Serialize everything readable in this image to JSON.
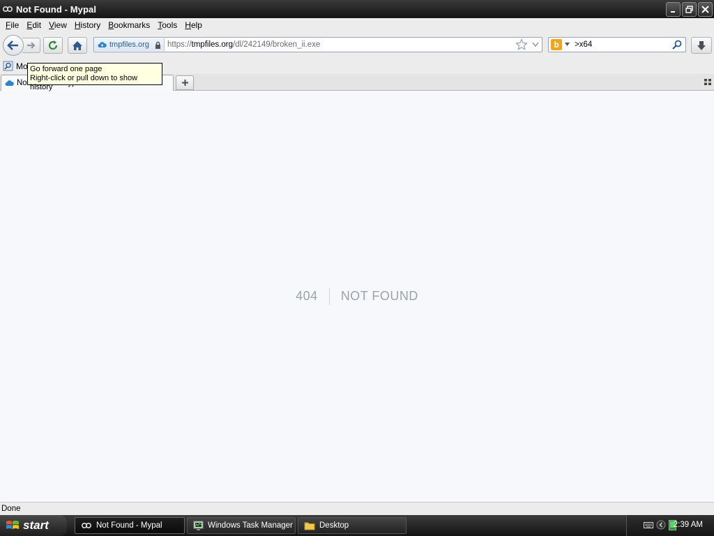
{
  "window": {
    "title": "Not Found - Mypal",
    "controls": {
      "minimize": "minimize",
      "restore": "restore",
      "close": "close"
    }
  },
  "menu": [
    {
      "accel": "F",
      "rest": "ile"
    },
    {
      "accel": "E",
      "rest": "dit"
    },
    {
      "accel": "V",
      "rest": "iew"
    },
    {
      "accel": "H",
      "rest": "istory"
    },
    {
      "accel": "B",
      "rest": "ookmarks"
    },
    {
      "accel": "T",
      "rest": "ools"
    },
    {
      "accel": "H",
      "rest": "elp"
    }
  ],
  "navbar": {
    "identity_label": "tmpfiles.org",
    "url_prefix": "https://",
    "url_host": "tmpfiles.org",
    "url_path": "/dl/242149/broken_ii.exe",
    "search_value": ">x64"
  },
  "bookmarks": {
    "first_item": "Mos"
  },
  "tooltip": {
    "line1": "Go forward one page",
    "line2": "Right-click or pull down to show history"
  },
  "tab": {
    "title": "Not Found - Mypal"
  },
  "content": {
    "error_code": "404",
    "error_message": "NOT FOUND"
  },
  "status": {
    "text": "Done"
  },
  "taskbar": {
    "start_label": "start",
    "tasks": [
      {
        "label": "Not Found - Mypal",
        "icon": "mypal-icon",
        "active": true
      },
      {
        "label": "Windows Task Manager",
        "icon": "task-manager-icon",
        "active": false
      },
      {
        "label": "Desktop",
        "icon": "folder-icon",
        "active": false
      }
    ],
    "clock": "2:39 AM"
  },
  "colors": {
    "content_bg": "#f6f8fb",
    "error_text": "#9aa3ab",
    "tooltip_bg": "#ffffe1",
    "bing_orange": "#f3a51a"
  }
}
